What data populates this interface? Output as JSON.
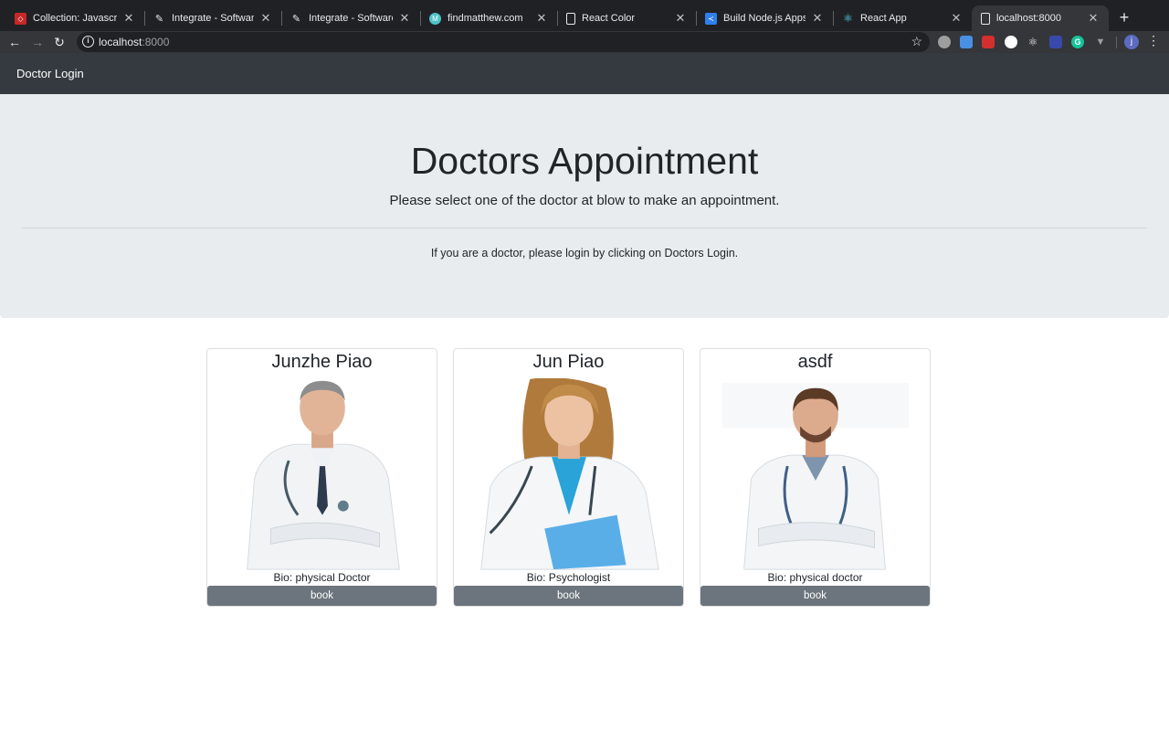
{
  "browser": {
    "tabs": [
      {
        "label": "Collection: Javascript | ",
        "favicon": "codepen-icon",
        "color": "#e53935"
      },
      {
        "label": "Integrate - Software En",
        "favicon": "quill-icon",
        "color": "#ffffff"
      },
      {
        "label": "Integrate - Software En",
        "favicon": "quill-icon",
        "color": "#ffffff"
      },
      {
        "label": "findmatthew.com",
        "favicon": "globe-icon",
        "color": "#4fc3c7"
      },
      {
        "label": "React Color",
        "favicon": "page-icon",
        "color": "#ffffff"
      },
      {
        "label": "Build Node.js Apps with",
        "favicon": "vscode-icon",
        "color": "#2f80ed"
      },
      {
        "label": "React App",
        "favicon": "react-icon",
        "color": "#61dafb"
      },
      {
        "label": "localhost:8000",
        "favicon": "page-icon",
        "color": "#ffffff"
      }
    ],
    "url_host": "localhost",
    "url_port": ":8000",
    "profile_initial": "j"
  },
  "nav": {
    "brand": "Doctor Login"
  },
  "hero": {
    "title": "Doctors Appointment",
    "subtitle": "Please select one of the doctor at blow to make an appointment.",
    "note": "If you are a doctor, please login by clicking on Doctors Login."
  },
  "doctors": [
    {
      "name": "Junzhe Piao",
      "bio": "Bio: physical Doctor",
      "button": "book"
    },
    {
      "name": "Jun Piao",
      "bio": "Bio: Psychologist",
      "button": "book"
    },
    {
      "name": "asdf",
      "bio": "Bio: physical doctor",
      "button": "book"
    }
  ],
  "colors": {
    "navbar": "#343a40",
    "jumbotron": "#e9ecef",
    "button": "#6c757d"
  }
}
